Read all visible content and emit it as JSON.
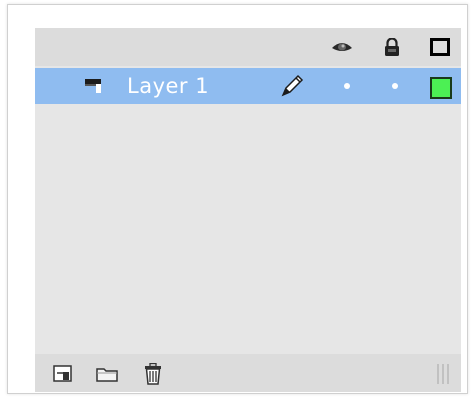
{
  "panel": {
    "header_icons": [
      "eye-icon",
      "lock-icon",
      "outline-icon"
    ],
    "layers": [
      {
        "name": "Layer 1",
        "selected": true,
        "type_icon": "layer-icon",
        "edit_icon": "pencil-icon",
        "visible": true,
        "locked": false,
        "outline_color": "#4cf054"
      }
    ],
    "footer_icons": [
      "new-layer-icon",
      "new-folder-icon",
      "trash-icon",
      "resize-grip-icon"
    ]
  },
  "colors": {
    "selection": "#8fbcf0",
    "panel_bg": "#e6e6e6",
    "header_bg": "#dcdcdc"
  }
}
